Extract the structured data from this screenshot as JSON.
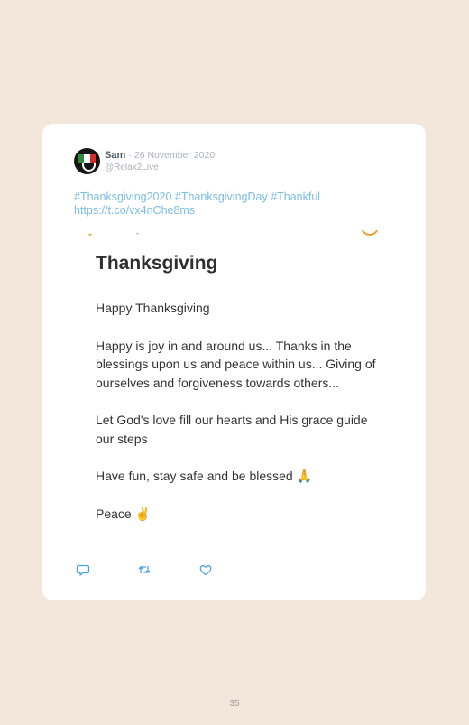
{
  "tweet": {
    "author_name": "Sam",
    "separator": "·",
    "date": "26 November 2020",
    "handle": "@Relax2Live",
    "hashtags_line": "#Thanksgiving2020 #ThanksgivingDay #Thankful",
    "link": "https://t.co/vx4nChe8ms"
  },
  "note": {
    "title": "Thanksgiving",
    "paragraphs": [
      "Happy Thanksgiving",
      "Happy is joy in and around us... Thanks in the blessings upon us and peace within us... Giving of ourselves and forgiveness towards others...",
      "Let God's love fill our hearts and His grace guide our steps",
      "Have fun, stay safe and be blessed 🙏",
      "Peace ✌️"
    ]
  },
  "actions": {
    "icons": [
      "reply-icon",
      "retweet-icon",
      "like-icon"
    ]
  },
  "page": {
    "number": "35"
  },
  "colors": {
    "background": "#f3e7dc",
    "card": "#ffffff",
    "link": "#7cbde3",
    "meta": "#aab2ba",
    "action_icon": "#4aa3df"
  }
}
